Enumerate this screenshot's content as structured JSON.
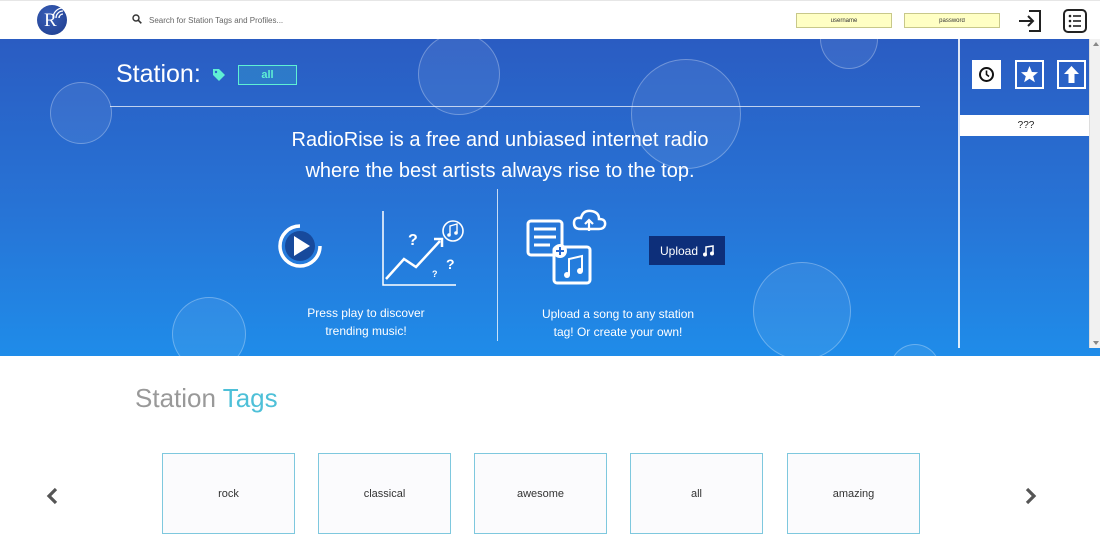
{
  "header": {
    "logo_letter": "R",
    "search": {
      "placeholder": "Search for Station Tags and Profiles..."
    },
    "username": {
      "placeholder": "username"
    },
    "password": {
      "placeholder": "password"
    }
  },
  "hero": {
    "station_label": "Station:",
    "station_value": "all",
    "tagline_line1": "RadioRise is a free and unbiased internet radio",
    "tagline_line2": "where the best artists always rise to the top.",
    "play_caption_line1": "Press play to discover",
    "play_caption_line2": "trending music!",
    "upload_button_label": "Upload",
    "upload_caption_line1": "Upload a song to any station",
    "upload_caption_line2": "tag! Or create your own!"
  },
  "side_panel": {
    "status_text": "???"
  },
  "station_tags": {
    "heading_part1": "Station",
    "heading_part2": "Tags",
    "tags": [
      "rock",
      "classical",
      "awesome",
      "all",
      "amazing"
    ]
  },
  "colors": {
    "hero_top": "#2a5cc2",
    "hero_bottom": "#1f8ce9",
    "accent_teal": "#5ff0d4",
    "heading_accent": "#4ec0d8",
    "upload_button": "#0d2f7a",
    "credential_fields": "#ffffc4"
  }
}
